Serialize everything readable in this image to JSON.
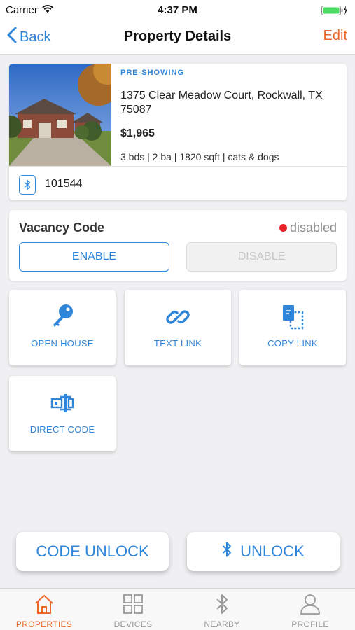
{
  "status_bar": {
    "carrier": "Carrier",
    "time": "4:37 PM",
    "wifi_icon": "wifi-icon",
    "battery_icon": "battery-charging-icon"
  },
  "nav": {
    "back_label": "Back",
    "title": "Property Details",
    "edit_label": "Edit"
  },
  "property": {
    "status": "PRE-SHOWING",
    "address": "1375 Clear Meadow Court, Rockwall, TX 75087",
    "price": "$1,965",
    "specs": "3 bds | 2 ba | 1820 sqft | cats & dogs",
    "device_id": "101544"
  },
  "vacancy": {
    "title": "Vacancy Code",
    "status": "disabled",
    "enable_label": "ENABLE",
    "disable_label": "DISABLE"
  },
  "actions": [
    {
      "label": "OPEN HOUSE",
      "icon": "key-icon"
    },
    {
      "label": "TEXT LINK",
      "icon": "link-icon"
    },
    {
      "label": "COPY LINK",
      "icon": "copy-icon"
    },
    {
      "label": "DIRECT CODE",
      "icon": "keypad-icon"
    }
  ],
  "bottom_buttons": {
    "code_unlock_label": "CODE UNLOCK",
    "unlock_label": "UNLOCK"
  },
  "tabs": [
    {
      "label": "PROPERTIES",
      "icon": "home-icon",
      "active": true
    },
    {
      "label": "DEVICES",
      "icon": "grid-icon",
      "active": false
    },
    {
      "label": "NEARBY",
      "icon": "bluetooth-icon",
      "active": false
    },
    {
      "label": "PROFILE",
      "icon": "person-icon",
      "active": false
    }
  ],
  "colors": {
    "accent_blue": "#2f86d9",
    "accent_orange": "#ea6a2b",
    "status_red": "#e8232a"
  }
}
